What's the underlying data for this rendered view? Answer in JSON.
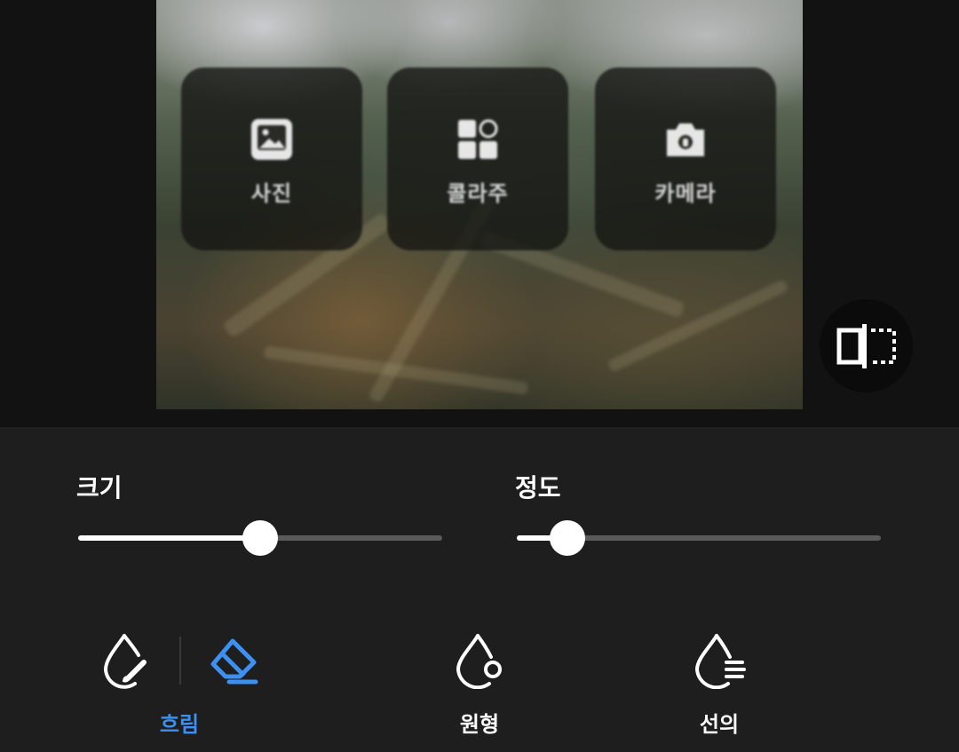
{
  "preview": {
    "tiles": [
      {
        "label": "사진",
        "icon": "image-icon"
      },
      {
        "label": "콜라주",
        "icon": "collage-grid-icon"
      },
      {
        "label": "카메라",
        "icon": "camera-icon"
      }
    ],
    "compare_icon": "compare-split-icon"
  },
  "sliders": {
    "size": {
      "label": "크기",
      "value": 0.5
    },
    "intensity": {
      "label": "정도",
      "value": 0.14
    }
  },
  "tools": {
    "blur": {
      "label": "흐림",
      "icon": "blur-drop-brush-icon",
      "selected": true
    },
    "eraser": {
      "icon": "eraser-icon",
      "active": true
    },
    "circle": {
      "label": "원형",
      "icon": "drop-circle-icon"
    },
    "linear": {
      "label": "선의",
      "icon": "drop-lines-icon"
    }
  },
  "colors": {
    "accent": "#3d8ff0",
    "panel": "#1e1e1e",
    "background": "#121212"
  }
}
